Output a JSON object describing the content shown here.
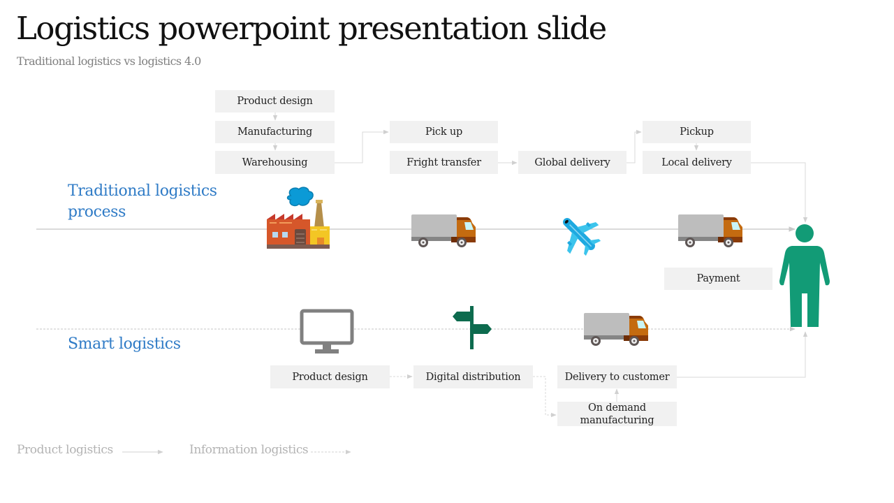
{
  "slide": {
    "title": "Logistics powerpoint presentation slide",
    "subtitle": "Traditional logistics vs logistics 4.0"
  },
  "traditional": {
    "label_line1": "Traditional logistics",
    "label_line2": "process",
    "steps": {
      "product_design": "Product design",
      "manufacturing": "Manufacturing",
      "warehousing": "Warehousing",
      "pick_up": "Pick up",
      "fright_transfer": "Fright transfer",
      "global_delivery": "Global delivery",
      "pickup": "Pickup",
      "local_delivery": "Local delivery",
      "payment": "Payment"
    },
    "icons": [
      "factory-icon",
      "truck-icon",
      "airplane-icon",
      "truck-icon",
      "person-icon"
    ]
  },
  "smart": {
    "label": "Smart logistics",
    "steps": {
      "product_design": "Product design",
      "digital_distribution": "Digital distribution",
      "delivery_to_customer": "Delivery to customer",
      "on_demand_line1": "On demand",
      "on_demand_line2": "manufacturing"
    },
    "icons": [
      "monitor-icon",
      "signpost-icon",
      "truck-icon"
    ]
  },
  "legend": {
    "product_logistics": "Product logistics",
    "information_logistics": "Information logistics"
  },
  "colors": {
    "section_label": "#2f7bc6",
    "box_fill": "#f1f1f1",
    "connector": "#d0d0d0",
    "person": "#129b76",
    "signpost": "#0d6b4e",
    "monitor": "#808080"
  }
}
